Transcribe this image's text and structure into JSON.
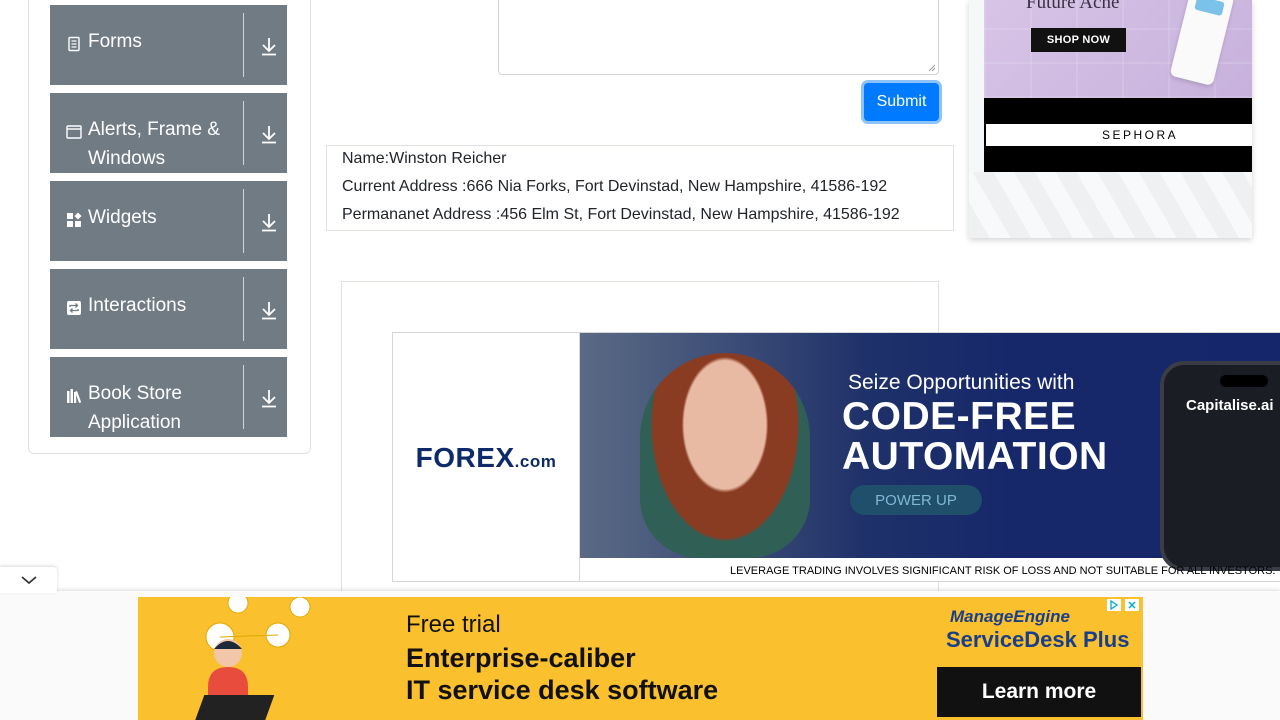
{
  "sidebar": {
    "groups": [
      {
        "label": "Forms",
        "icon": "document-icon"
      },
      {
        "label": "Alerts, Frame & Windows",
        "icon": "window-icon"
      },
      {
        "label": "Widgets",
        "icon": "widgets-icon"
      },
      {
        "label": "Interactions",
        "icon": "interactions-icon"
      },
      {
        "label": "Book Store Application",
        "icon": "books-icon"
      }
    ]
  },
  "form": {
    "submit_label": "Submit"
  },
  "output": {
    "name": "Name:Winston Reicher",
    "current_address": "Current Address :666 Nia Forks, Fort Devinstad, New Hampshire, 41586-192",
    "permanent_address": "Permananet Address :456 Elm St, Fort Devinstad, New Hampshire, 41586-192"
  },
  "ads": {
    "sephora": {
      "headline": "Future Acne",
      "cta": "SHOP NOW",
      "brand": "SEPHORA"
    },
    "forex": {
      "logo_main": "FOREX",
      "logo_suffix": ".com",
      "tagline": "Seize Opportunities with",
      "headline_1": "CODE-FREE",
      "headline_2": "AUTOMATION",
      "cta": "POWER UP",
      "phone_brand": "Capitalise.ai",
      "disclaimer": "LEVERAGE TRADING INVOLVES SIGNIFICANT RISK OF LOSS AND NOT SUITABLE FOR ALL INVESTORS."
    },
    "manageengine": {
      "line1": "Free trial",
      "line2": "Enterprise-caliber",
      "line3": "IT service desk software",
      "brand1": "ManageEngine",
      "brand2": "ServiceDesk Plus",
      "cta": "Learn more"
    }
  },
  "colors": {
    "sidebar_group_bg": "#717b84",
    "primary": "#007bff",
    "ad_yellow": "#fbc02d"
  }
}
